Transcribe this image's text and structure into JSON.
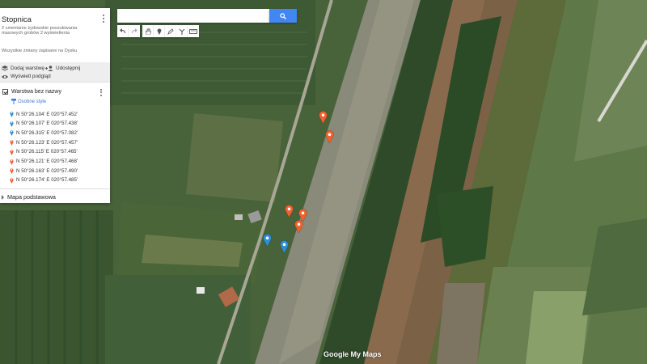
{
  "map": {
    "title": "Stopnica",
    "description": "2 cmentarze żydowskie poszukiwania masowych grobów 2 wyświetlenia",
    "save_status": "Wszystkie zmiany zapisane na Dysku",
    "actions": {
      "add_layer": "Dodaj warstwę",
      "share": "Udostępnij",
      "preview": "Wyświetl podgląd"
    },
    "layer": {
      "name": "Warstwa bez nazwy",
      "styles_link": "Osobne style",
      "points": [
        {
          "label": "N 50°26.104' E 020°57.452'",
          "color": "#2d8fd5"
        },
        {
          "label": "N 50°26.107' E 020°57.438'",
          "color": "#2d8fd5"
        },
        {
          "label": "N 50°26.315' E 020°57.082'",
          "color": "#2d8fd5"
        },
        {
          "label": "N 50°26.123' E 020°57.457'",
          "color": "#f2602d"
        },
        {
          "label": "N 50°26.115' E 020°57.465'",
          "color": "#f2602d"
        },
        {
          "label": "N 50°26.121' E 020°57.468'",
          "color": "#f2602d"
        },
        {
          "label": "N 50°26.163' E 020°57.490'",
          "color": "#f2602d"
        },
        {
          "label": "N 50°26.174' E 020°57.485'",
          "color": "#f2602d"
        }
      ]
    },
    "basemap_label": "Mapa podstawowa"
  },
  "search": {
    "placeholder": "",
    "value": ""
  },
  "toolbar": {
    "icons": [
      "undo-icon",
      "redo-icon",
      "hand-icon",
      "marker-icon",
      "lasso-icon",
      "route-icon",
      "ruler-icon"
    ]
  },
  "watermark": "Google My Maps",
  "colors": {
    "accent": "#4285f4",
    "marker_blue": "#2d8fd5",
    "marker_orange": "#f2602d"
  }
}
